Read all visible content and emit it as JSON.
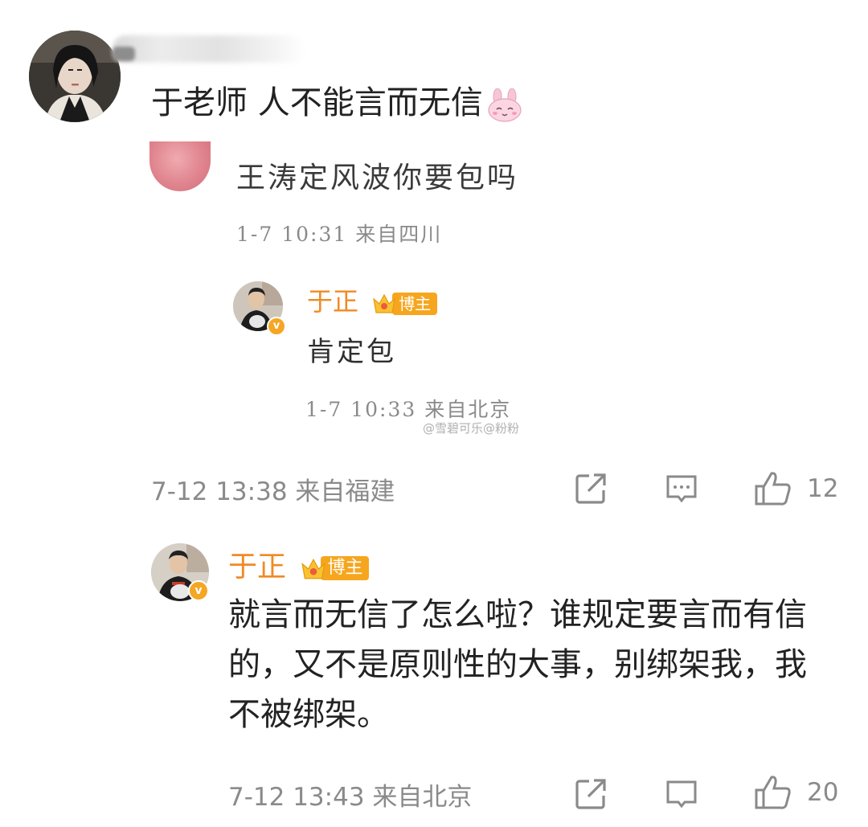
{
  "comment": {
    "text": "于老师 人不能言而无信",
    "emoji": "bunny-emoji",
    "date": "7-12 13:38",
    "location": "来自福建",
    "likes": "12"
  },
  "embedded_screenshot": {
    "comment_text": "王涛定风波你要包吗",
    "comment_meta": "1-7 10:31  来自四川",
    "reply_author": "于正",
    "reply_badge": "博主",
    "reply_text": "肯定包",
    "reply_meta": "1-7 10:33  来自北京",
    "watermark": "@雪碧可乐@粉粉"
  },
  "reply": {
    "author": "于正",
    "badge": "博主",
    "text": "就言而无信了怎么啦？谁规定要言而有信的，又不是原则性的大事，别绑架我，我不被绑架。",
    "date": "7-12 13:43",
    "location": "来自北京",
    "likes": "20"
  },
  "colors": {
    "author_orange": "#f08a24",
    "badge_orange": "#f6a61e",
    "meta_gray": "#8a8a8a",
    "icon_gray": "#8a8a8a"
  },
  "icons": [
    "share-icon",
    "comment-icon",
    "like-icon",
    "verified-v-icon",
    "crown-icon"
  ]
}
